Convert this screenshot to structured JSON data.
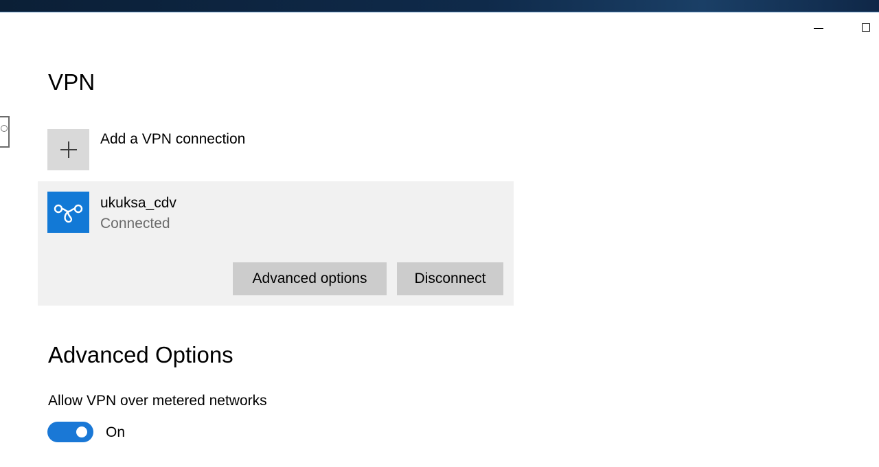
{
  "window": {
    "controls": {
      "minimize_icon": "minimize-icon",
      "maximize_icon": "maximize-icon"
    }
  },
  "page": {
    "title": "VPN"
  },
  "add_connection": {
    "label": "Add a VPN connection",
    "icon": "plus-icon"
  },
  "connection": {
    "name": "ukuksa_cdv",
    "status": "Connected",
    "icon": "vpn-link-icon",
    "advanced_options_label": "Advanced options",
    "disconnect_label": "Disconnect"
  },
  "advanced": {
    "title": "Advanced Options",
    "metered_label": "Allow VPN over metered networks",
    "metered_toggle_state": "On",
    "metered_toggle_on": true
  },
  "colors": {
    "accent": "#1279d6",
    "card_background": "#f1f1f1",
    "button_background": "#cccccc",
    "status_text": "#6b6b6b"
  }
}
